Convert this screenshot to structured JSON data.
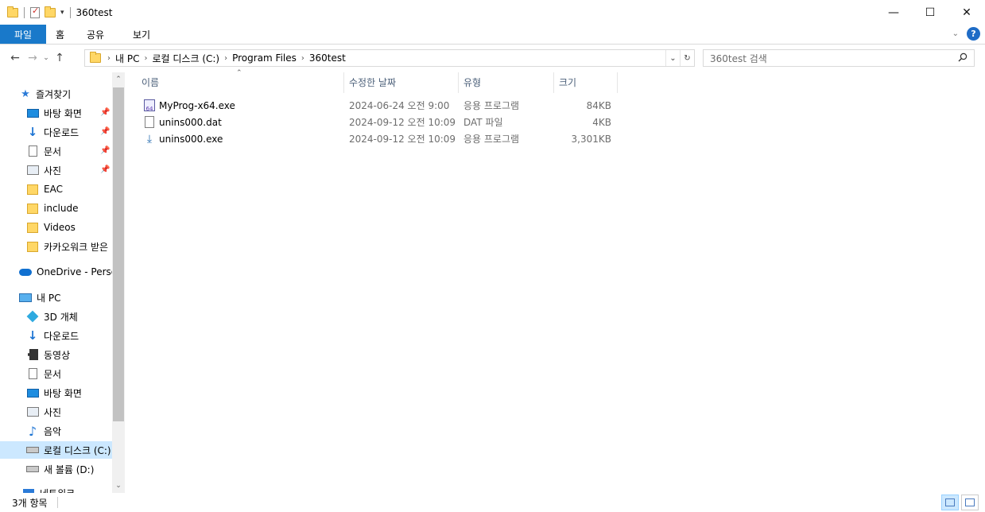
{
  "window": {
    "title": "360test"
  },
  "ribbon": {
    "tabs": [
      "파일",
      "홈",
      "공유",
      "보기"
    ]
  },
  "address": {
    "crumbs": [
      "내 PC",
      "로컬 디스크 (C:)",
      "Program Files",
      "360test"
    ]
  },
  "search": {
    "placeholder": "360test 검색"
  },
  "sidebar": {
    "quick_access_label": "즐겨찾기",
    "quick_items": [
      {
        "label": "바탕 화면",
        "icon": "desktop-icon",
        "pinned": true
      },
      {
        "label": "다운로드",
        "icon": "download-icon",
        "pinned": true
      },
      {
        "label": "문서",
        "icon": "document-icon",
        "pinned": true
      },
      {
        "label": "사진",
        "icon": "pictures-icon",
        "pinned": true
      },
      {
        "label": "EAC",
        "icon": "folder-icon",
        "pinned": false
      },
      {
        "label": "include",
        "icon": "folder-icon",
        "pinned": false
      },
      {
        "label": "Videos",
        "icon": "folder-icon",
        "pinned": false
      },
      {
        "label": "카카오워크 받은",
        "icon": "folder-icon",
        "pinned": false
      }
    ],
    "onedrive_label": "OneDrive - Persor",
    "this_pc_label": "내 PC",
    "pc_items": [
      {
        "label": "3D 개체",
        "icon": "3d-objects-icon"
      },
      {
        "label": "다운로드",
        "icon": "download-icon"
      },
      {
        "label": "동영상",
        "icon": "video-icon"
      },
      {
        "label": "문서",
        "icon": "document-icon"
      },
      {
        "label": "바탕 화면",
        "icon": "desktop-icon"
      },
      {
        "label": "사진",
        "icon": "pictures-icon"
      },
      {
        "label": "음악",
        "icon": "music-icon"
      },
      {
        "label": "로컬 디스크 (C:)",
        "icon": "local-disk-icon",
        "selected": true
      },
      {
        "label": "새 볼륨 (D:)",
        "icon": "volume-icon"
      }
    ],
    "network_label": "네트워크"
  },
  "columns": {
    "name": "이름",
    "modified": "수정한 날짜",
    "type": "유형",
    "size": "크기"
  },
  "files": [
    {
      "name": "MyProg-x64.exe",
      "modified": "2024-06-24 오전 9:00",
      "type": "응용 프로그램",
      "size": "84KB",
      "icon": "exe-x64-icon"
    },
    {
      "name": "unins000.dat",
      "modified": "2024-09-12 오전 10:09",
      "type": "DAT 파일",
      "size": "4KB",
      "icon": "file-icon"
    },
    {
      "name": "unins000.exe",
      "modified": "2024-09-12 오전 10:09",
      "type": "응용 프로그램",
      "size": "3,301KB",
      "icon": "setup-exe-icon"
    }
  ],
  "status": {
    "item_count": "3개 항목"
  },
  "colors": {
    "accent": "#1979ca",
    "selection": "#cce8ff"
  }
}
